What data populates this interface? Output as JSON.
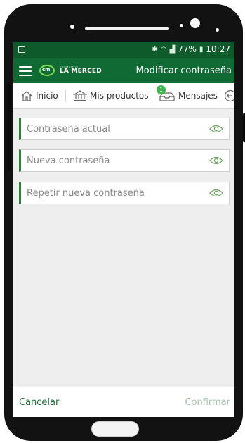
{
  "status": {
    "battery": "77%",
    "time": "10:27"
  },
  "appbar": {
    "title": "Modificar contraseña",
    "logo_small": "COOPERATIVA",
    "logo_main": "LA MERCED"
  },
  "tabs": [
    {
      "label": "Inicio"
    },
    {
      "label": "Mis productos"
    },
    {
      "label": "Mensajes",
      "badge": "1"
    }
  ],
  "form": {
    "current_placeholder": "Contraseña actual",
    "new_placeholder": "Nueva contraseña",
    "repeat_placeholder": "Repetir nueva contraseña"
  },
  "actions": {
    "cancel": "Cancelar",
    "confirm": "Confirmar"
  },
  "colors": {
    "primary": "#0f6b33",
    "accent": "#3bb54a",
    "disabled": "#a7c4ad"
  }
}
